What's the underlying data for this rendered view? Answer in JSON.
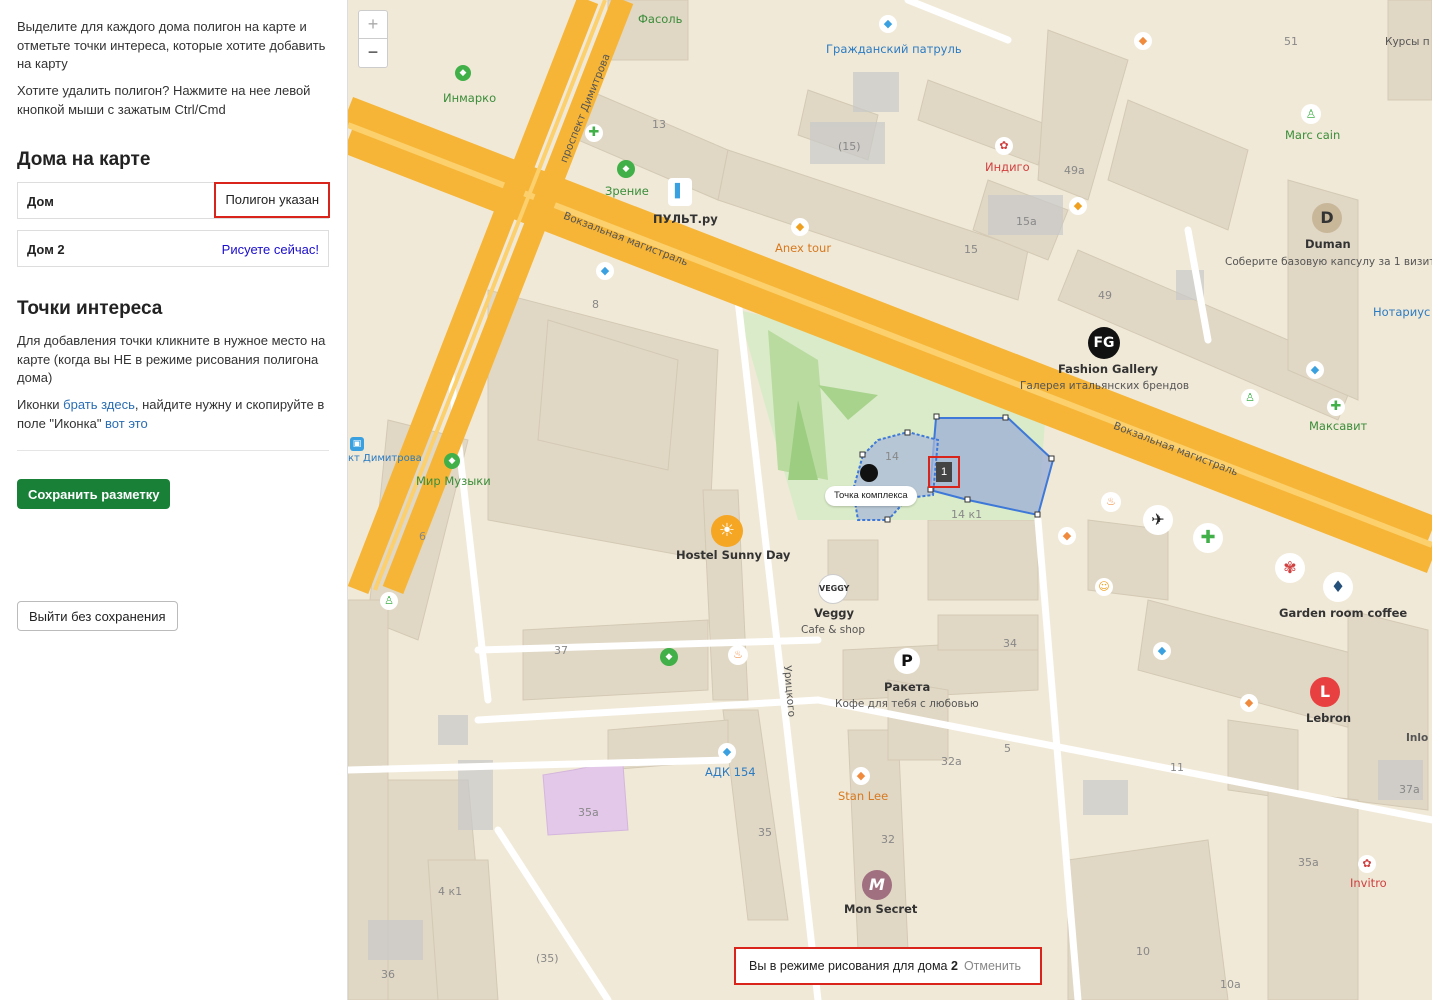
{
  "sidebar": {
    "intro": "Выделите для каждого дома полигон на карте и отметьте точки интереса, которые хотите добавить на карту",
    "delete_hint": "Хотите удалить полигон? Нажмите на нее левой кнопкой мыши с зажатым Ctrl/Cmd",
    "houses_title": "Дома на карте",
    "houses": [
      {
        "name": "Дом",
        "status": "Полигон указан"
      },
      {
        "name": "Дом 2",
        "status": "Рисуете сейчас!"
      }
    ],
    "poi_title": "Точки интереса",
    "poi_hint": "Для добавления точки кликните в нужное место на карте (когда вы НЕ в режиме рисования полигона дома)",
    "icons_prefix": "Иконки ",
    "icons_link": "брать здесь",
    "icons_middle": ", найдите нужну и скопируйте в поле \"Иконка\" ",
    "icons_link2": "вот это",
    "save_button": "Сохранить разметку",
    "exit_button": "Выйти без сохранения"
  },
  "map": {
    "zoom_in": "+",
    "zoom_out": "−",
    "drawing_text": "Вы в режиме рисования для дома ",
    "drawing_house": "2",
    "drawing_cancel": "Отменить",
    "tooltip": "Точка комплекса",
    "polygon_label": "1",
    "streets": {
      "vokzal1": "Вокзальная магистраль",
      "vokzal2": "Вокзальная магистраль",
      "dimitrova": "проспект Димитрова",
      "uritskogo": "Урицкого",
      "dimitrova_stop": "кт Димитрова"
    },
    "places": {
      "fasol": "Фасоль",
      "patrol": "Гражданский патруль",
      "inmarko": "Инмарко",
      "zrenie": "Зрение",
      "pult": "ПУЛЬТ.ру",
      "anex": "Anex tour",
      "indigo": "Индиго",
      "marc": "Marc cain",
      "duman": "Duman",
      "duman_sub": "Соберите базовую капсулу за 1 визит",
      "notarius": "Нотариус",
      "fg": "Fashion Gallery",
      "fg_sub": "Галерея итальянских брендов",
      "maksavit": "Максавит",
      "mir_muzyki": "Мир Музыки",
      "hostel": "Hostel Sunny Day",
      "veggy": "Veggy",
      "veggy_sub": "Cafe & shop",
      "garden": "Garden room coffee",
      "raketa": "Ракета",
      "raketa_sub": "Кофе для тебя с любовью",
      "lebron": "Lebron",
      "adk": "АДК 154",
      "stanlee": "Stan Lee",
      "monsecret": "Mon Secret",
      "invitro": "Invitro",
      "kursy": "Курсы п",
      "inlo": "Inlo"
    },
    "numbers": {
      "n51": "51",
      "n13": "13",
      "n15p": "(15)",
      "n49a": "49а",
      "n15a": "15а",
      "n15": "15",
      "n49": "49",
      "n8": "8",
      "n14": "14",
      "n14k1": "14 к1",
      "n6": "6",
      "n37": "37",
      "n34": "34",
      "n32a": "32а",
      "n5": "5",
      "n11": "11",
      "n37a": "37а",
      "n35a": "35а",
      "n35": "35",
      "n32": "32",
      "n35a2": "35а",
      "n4k1": "4 к1",
      "n35p": "(35)",
      "n36": "36",
      "n10": "10",
      "n10a": "10а"
    }
  }
}
